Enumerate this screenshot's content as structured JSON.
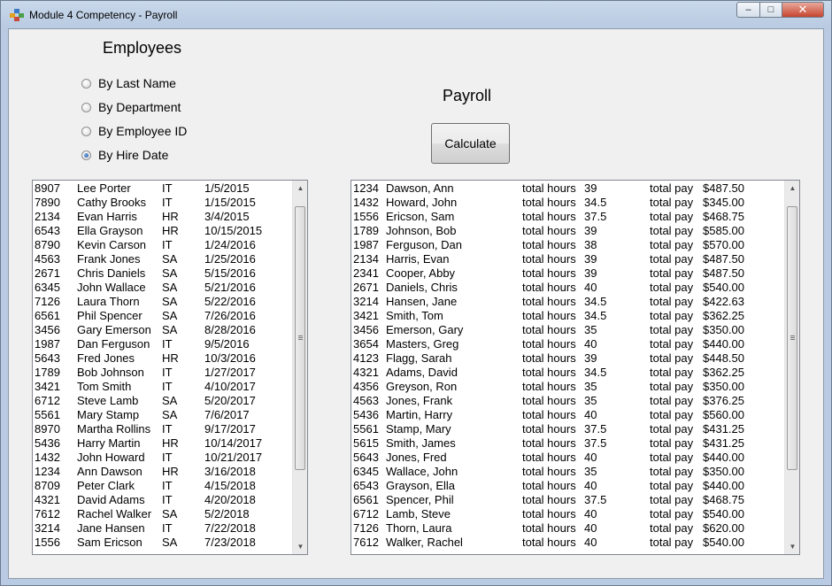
{
  "window": {
    "title": "Module 4 Competency - Payroll"
  },
  "headings": {
    "employees": "Employees",
    "payroll": "Payroll"
  },
  "sort_options": [
    {
      "label": "By Last Name",
      "checked": false
    },
    {
      "label": "By Department",
      "checked": false
    },
    {
      "label": "By Employee ID",
      "checked": false
    },
    {
      "label": "By Hire Date",
      "checked": true
    }
  ],
  "calculate_label": "Calculate",
  "employees": [
    {
      "id": "8907",
      "name": "Lee Porter",
      "dept": "IT",
      "hire": "1/5/2015"
    },
    {
      "id": "7890",
      "name": "Cathy Brooks",
      "dept": "IT",
      "hire": "1/15/2015"
    },
    {
      "id": "2134",
      "name": "Evan Harris",
      "dept": "HR",
      "hire": "3/4/2015"
    },
    {
      "id": "6543",
      "name": "Ella Grayson",
      "dept": "HR",
      "hire": "10/15/2015"
    },
    {
      "id": "8790",
      "name": "Kevin Carson",
      "dept": "IT",
      "hire": "1/24/2016"
    },
    {
      "id": "4563",
      "name": "Frank Jones",
      "dept": "SA",
      "hire": "1/25/2016"
    },
    {
      "id": "2671",
      "name": "Chris Daniels",
      "dept": "SA",
      "hire": "5/15/2016"
    },
    {
      "id": "6345",
      "name": "John Wallace",
      "dept": "SA",
      "hire": "5/21/2016"
    },
    {
      "id": "7126",
      "name": "Laura Thorn",
      "dept": "SA",
      "hire": "5/22/2016"
    },
    {
      "id": "6561",
      "name": "Phil Spencer",
      "dept": "SA",
      "hire": "7/26/2016"
    },
    {
      "id": "3456",
      "name": "Gary Emerson",
      "dept": "SA",
      "hire": "8/28/2016"
    },
    {
      "id": "1987",
      "name": "Dan Ferguson",
      "dept": "IT",
      "hire": "9/5/2016"
    },
    {
      "id": "5643",
      "name": "Fred Jones",
      "dept": "HR",
      "hire": "10/3/2016"
    },
    {
      "id": "1789",
      "name": "Bob Johnson",
      "dept": "IT",
      "hire": "1/27/2017"
    },
    {
      "id": "3421",
      "name": "Tom Smith",
      "dept": "IT",
      "hire": "4/10/2017"
    },
    {
      "id": "6712",
      "name": "Steve Lamb",
      "dept": "SA",
      "hire": "5/20/2017"
    },
    {
      "id": "5561",
      "name": "Mary Stamp",
      "dept": "SA",
      "hire": "7/6/2017"
    },
    {
      "id": "8970",
      "name": "Martha Rollins",
      "dept": "IT",
      "hire": "9/17/2017"
    },
    {
      "id": "5436",
      "name": "Harry Martin",
      "dept": "HR",
      "hire": "10/14/2017"
    },
    {
      "id": "1432",
      "name": "John Howard",
      "dept": "IT",
      "hire": "10/21/2017"
    },
    {
      "id": "1234",
      "name": "Ann Dawson",
      "dept": "HR",
      "hire": "3/16/2018"
    },
    {
      "id": "8709",
      "name": "Peter Clark",
      "dept": "IT",
      "hire": "4/15/2018"
    },
    {
      "id": "4321",
      "name": "David Adams",
      "dept": "IT",
      "hire": "4/20/2018"
    },
    {
      "id": "7612",
      "name": "Rachel Walker",
      "dept": "SA",
      "hire": "5/2/2018"
    },
    {
      "id": "3214",
      "name": "Jane Hansen",
      "dept": "IT",
      "hire": "7/22/2018"
    },
    {
      "id": "1556",
      "name": "Sam Ericson",
      "dept": "SA",
      "hire": "7/23/2018"
    }
  ],
  "payroll_hours_label": "total hours",
  "payroll_pay_label": "total pay",
  "payroll": [
    {
      "id": "1234",
      "name": "Dawson, Ann",
      "hours": "39",
      "pay": "$487.50"
    },
    {
      "id": "1432",
      "name": "Howard, John",
      "hours": "34.5",
      "pay": "$345.00"
    },
    {
      "id": "1556",
      "name": "Ericson, Sam",
      "hours": "37.5",
      "pay": "$468.75"
    },
    {
      "id": "1789",
      "name": "Johnson, Bob",
      "hours": "39",
      "pay": "$585.00"
    },
    {
      "id": "1987",
      "name": "Ferguson, Dan",
      "hours": "38",
      "pay": "$570.00"
    },
    {
      "id": "2134",
      "name": "Harris, Evan",
      "hours": "39",
      "pay": "$487.50"
    },
    {
      "id": "2341",
      "name": "Cooper, Abby",
      "hours": "39",
      "pay": "$487.50"
    },
    {
      "id": "2671",
      "name": "Daniels, Chris",
      "hours": "40",
      "pay": "$540.00"
    },
    {
      "id": "3214",
      "name": "Hansen, Jane",
      "hours": "34.5",
      "pay": "$422.63"
    },
    {
      "id": "3421",
      "name": "Smith, Tom",
      "hours": "34.5",
      "pay": "$362.25"
    },
    {
      "id": "3456",
      "name": "Emerson, Gary",
      "hours": "35",
      "pay": "$350.00"
    },
    {
      "id": "3654",
      "name": "Masters, Greg",
      "hours": "40",
      "pay": "$440.00"
    },
    {
      "id": "4123",
      "name": "Flagg, Sarah",
      "hours": "39",
      "pay": "$448.50"
    },
    {
      "id": "4321",
      "name": "Adams, David",
      "hours": "34.5",
      "pay": "$362.25"
    },
    {
      "id": "4356",
      "name": "Greyson, Ron",
      "hours": "35",
      "pay": "$350.00"
    },
    {
      "id": "4563",
      "name": "Jones, Frank",
      "hours": "35",
      "pay": "$376.25"
    },
    {
      "id": "5436",
      "name": "Martin, Harry",
      "hours": "40",
      "pay": "$560.00"
    },
    {
      "id": "5561",
      "name": "Stamp, Mary",
      "hours": "37.5",
      "pay": "$431.25"
    },
    {
      "id": "5615",
      "name": "Smith, James",
      "hours": "37.5",
      "pay": "$431.25"
    },
    {
      "id": "5643",
      "name": "Jones, Fred",
      "hours": "40",
      "pay": "$440.00"
    },
    {
      "id": "6345",
      "name": "Wallace, John",
      "hours": "35",
      "pay": "$350.00"
    },
    {
      "id": "6543",
      "name": "Grayson, Ella",
      "hours": "40",
      "pay": "$440.00"
    },
    {
      "id": "6561",
      "name": "Spencer, Phil",
      "hours": "37.5",
      "pay": "$468.75"
    },
    {
      "id": "6712",
      "name": "Lamb, Steve",
      "hours": "40",
      "pay": "$540.00"
    },
    {
      "id": "7126",
      "name": "Thorn, Laura",
      "hours": "40",
      "pay": "$620.00"
    },
    {
      "id": "7612",
      "name": "Walker, Rachel",
      "hours": "40",
      "pay": "$540.00"
    }
  ],
  "scroll": {
    "employees_thumb_top_fraction": 0.03,
    "employees_thumb_size_fraction": 0.77,
    "payroll_thumb_top_fraction": 0.03,
    "payroll_thumb_size_fraction": 0.77
  },
  "colors": {
    "window_frame": "#b9cbe2",
    "client_bg": "#f0f0f0",
    "close_button": "#c6452f"
  }
}
